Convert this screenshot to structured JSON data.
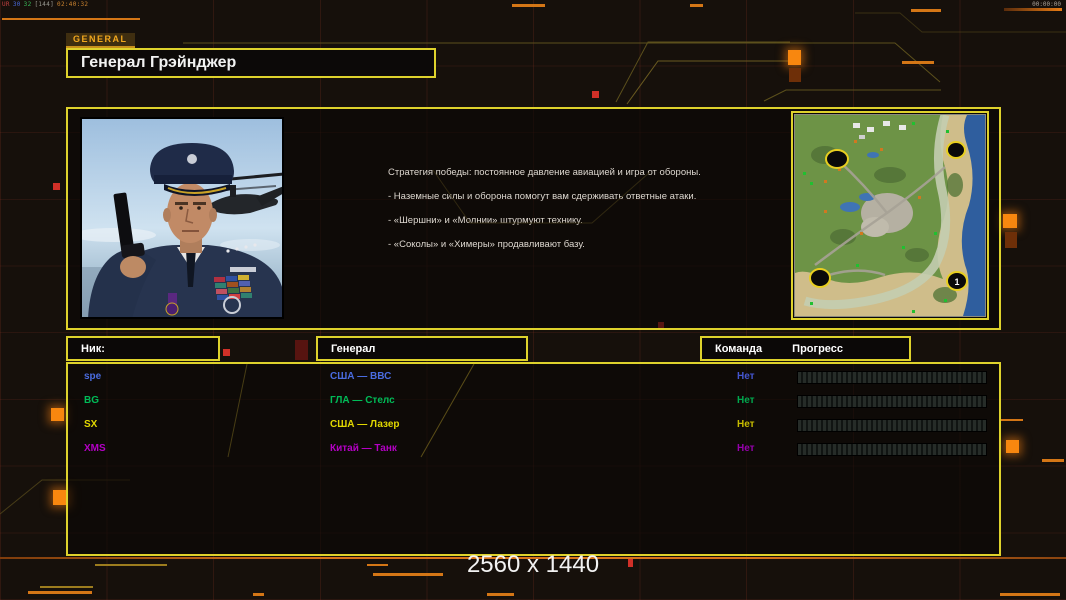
{
  "status": {
    "tokens": [
      {
        "text": "UR",
        "color": "#c04040"
      },
      {
        "text": "30",
        "color": "#4868d8"
      },
      {
        "text": "32",
        "color": "#38b858"
      },
      {
        "text": "[144]",
        "color": "#989890"
      },
      {
        "text": "02:40:32",
        "color": "#cc8430"
      }
    ],
    "clock": "00:00:00"
  },
  "header": {
    "tag": "GENERAL",
    "title": "Генерал Грэйнджер"
  },
  "briefing": {
    "paragraphs": [
      "Стратегия победы: постоянное давление авиацией и игра от обороны.",
      "- Наземные силы и оборона помогут вам сдерживать ответные атаки.",
      "- «Шершни» и «Молнии» штурмуют технику.",
      "- «Соколы» и «Химеры» продавливают базу."
    ]
  },
  "table": {
    "headers": {
      "nick": "Ник:",
      "general": "Генерал",
      "team": "Команда",
      "progress": "Прогресс"
    },
    "rows": [
      {
        "nick": "spe",
        "general": "США — ВВС",
        "team": "Нет",
        "color": "#4a6ce0",
        "team_color": "#4456d0",
        "progress_percent": 0
      },
      {
        "nick": "BG",
        "general": "ГЛА — Стелс",
        "team": "Нет",
        "color": "#00bc58",
        "team_color": "#00a84e",
        "progress_percent": 0
      },
      {
        "nick": "SX",
        "general": "США — Лазер",
        "team": "Нет",
        "color": "#e2d800",
        "team_color": "#c6bc00",
        "progress_percent": 0
      },
      {
        "nick": "XMS",
        "general": "Китай — Танк",
        "team": "Нет",
        "color": "#b400c4",
        "team_color": "#9600ac",
        "progress_percent": 0
      }
    ]
  },
  "minimap": {
    "spawn_number": "1"
  },
  "footer": {
    "resolution": "2560 x 1440"
  },
  "colors": {
    "accent_yellow": "#ded22c",
    "accent_orange": "#e87c14",
    "alert_red": "#d13028"
  }
}
